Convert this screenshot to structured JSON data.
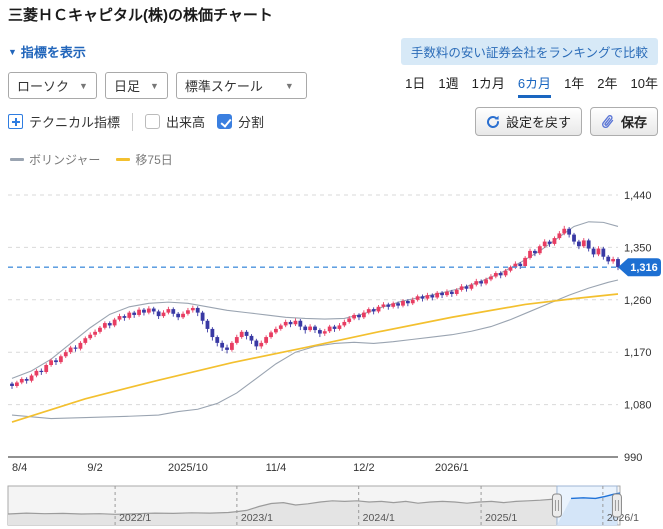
{
  "page": {
    "title": "三菱ＨＣキャピタル(株)の株価チャート"
  },
  "toolbar": {
    "indicator_toggle": "指標を表示",
    "caret_down": "▼",
    "promo_button": "手数料の安い証券会社をランキングで比較",
    "chart_type_select": "ローソク",
    "interval_select": "日足",
    "scale_select": "標準スケール",
    "periods": [
      {
        "label": "1日",
        "selected": false
      },
      {
        "label": "1週",
        "selected": false
      },
      {
        "label": "1カ月",
        "selected": false
      },
      {
        "label": "6カ月",
        "selected": true
      },
      {
        "label": "1年",
        "selected": false
      },
      {
        "label": "2年",
        "selected": false
      },
      {
        "label": "10年",
        "selected": false
      }
    ],
    "technical_button": "テクニカル指標",
    "volume_checkbox": {
      "label": "出来高",
      "checked": false
    },
    "split_checkbox": {
      "label": "分割",
      "checked": true
    },
    "reset_button": "設定を戻す",
    "save_button": "保存"
  },
  "legend": [
    {
      "name": "ボリンジャー",
      "color": "#9aa4b1"
    },
    {
      "name": "移75日",
      "color": "#f3c02f"
    }
  ],
  "chart_data": {
    "type": "candlestick",
    "title": "三菱ＨＣキャピタル(株) 日足 6カ月",
    "ylim": [
      990,
      1466
    ],
    "y_ticks": [
      990,
      1080,
      1170,
      1260,
      1350,
      1440
    ],
    "current_price": 1316,
    "x_ticks": [
      {
        "label": "8/4",
        "index": 0
      },
      {
        "label": "9/2",
        "index": 17
      },
      {
        "label": "2025/10",
        "index": 36
      },
      {
        "label": "11/4",
        "index": 54
      },
      {
        "label": "12/2",
        "index": 72
      },
      {
        "label": "2026/1",
        "index": 90
      }
    ],
    "candles": [
      [
        1116,
        1112,
        1107,
        1119
      ],
      [
        1112,
        1118,
        1109,
        1121
      ],
      [
        1118,
        1124,
        1115,
        1127
      ],
      [
        1124,
        1121,
        1116,
        1127
      ],
      [
        1121,
        1130,
        1118,
        1133
      ],
      [
        1130,
        1138,
        1127,
        1141
      ],
      [
        1138,
        1136,
        1131,
        1142
      ],
      [
        1136,
        1148,
        1133,
        1151
      ],
      [
        1148,
        1156,
        1145,
        1159
      ],
      [
        1156,
        1153,
        1148,
        1160
      ],
      [
        1153,
        1163,
        1150,
        1166
      ],
      [
        1163,
        1170,
        1160,
        1174
      ],
      [
        1170,
        1178,
        1167,
        1181
      ],
      [
        1178,
        1176,
        1171,
        1182
      ],
      [
        1176,
        1186,
        1173,
        1189
      ],
      [
        1186,
        1194,
        1183,
        1197
      ],
      [
        1194,
        1200,
        1191,
        1204
      ],
      [
        1200,
        1205,
        1196,
        1209
      ],
      [
        1205,
        1212,
        1202,
        1215
      ],
      [
        1212,
        1220,
        1209,
        1223
      ],
      [
        1220,
        1216,
        1211,
        1223
      ],
      [
        1216,
        1226,
        1213,
        1229
      ],
      [
        1226,
        1232,
        1223,
        1236
      ],
      [
        1232,
        1229,
        1224,
        1235
      ],
      [
        1229,
        1238,
        1226,
        1241
      ],
      [
        1238,
        1234,
        1229,
        1241
      ],
      [
        1234,
        1243,
        1231,
        1247
      ],
      [
        1243,
        1238,
        1233,
        1246
      ],
      [
        1238,
        1245,
        1235,
        1249
      ],
      [
        1245,
        1240,
        1235,
        1248
      ],
      [
        1240,
        1232,
        1227,
        1243
      ],
      [
        1232,
        1238,
        1229,
        1242
      ],
      [
        1238,
        1244,
        1235,
        1248
      ],
      [
        1244,
        1236,
        1231,
        1247
      ],
      [
        1236,
        1230,
        1225,
        1239
      ],
      [
        1230,
        1236,
        1227,
        1240
      ],
      [
        1236,
        1242,
        1233,
        1246
      ],
      [
        1242,
        1246,
        1238,
        1250
      ],
      [
        1246,
        1238,
        1232,
        1249
      ],
      [
        1238,
        1224,
        1218,
        1241
      ],
      [
        1224,
        1210,
        1204,
        1227
      ],
      [
        1210,
        1196,
        1190,
        1213
      ],
      [
        1196,
        1186,
        1180,
        1199
      ],
      [
        1186,
        1178,
        1172,
        1190
      ],
      [
        1178,
        1174,
        1168,
        1183
      ],
      [
        1174,
        1186,
        1171,
        1189
      ],
      [
        1186,
        1196,
        1183,
        1200
      ],
      [
        1196,
        1205,
        1193,
        1208
      ],
      [
        1205,
        1198,
        1192,
        1208
      ],
      [
        1198,
        1190,
        1184,
        1201
      ],
      [
        1190,
        1180,
        1174,
        1193
      ],
      [
        1180,
        1186,
        1176,
        1190
      ],
      [
        1186,
        1196,
        1183,
        1199
      ],
      [
        1196,
        1204,
        1193,
        1207
      ],
      [
        1204,
        1210,
        1201,
        1214
      ],
      [
        1210,
        1216,
        1207,
        1219
      ],
      [
        1216,
        1222,
        1213,
        1226
      ],
      [
        1222,
        1218,
        1213,
        1225
      ],
      [
        1218,
        1224,
        1215,
        1228
      ],
      [
        1224,
        1214,
        1208,
        1227
      ],
      [
        1214,
        1208,
        1202,
        1217
      ],
      [
        1208,
        1214,
        1205,
        1218
      ],
      [
        1214,
        1208,
        1203,
        1217
      ],
      [
        1208,
        1202,
        1196,
        1211
      ],
      [
        1202,
        1206,
        1198,
        1210
      ],
      [
        1206,
        1214,
        1203,
        1217
      ],
      [
        1214,
        1210,
        1205,
        1217
      ],
      [
        1210,
        1216,
        1207,
        1220
      ],
      [
        1216,
        1222,
        1213,
        1226
      ],
      [
        1222,
        1228,
        1219,
        1232
      ],
      [
        1228,
        1234,
        1225,
        1237
      ],
      [
        1234,
        1230,
        1225,
        1237
      ],
      [
        1230,
        1238,
        1227,
        1242
      ],
      [
        1238,
        1244,
        1235,
        1247
      ],
      [
        1244,
        1240,
        1235,
        1247
      ],
      [
        1240,
        1248,
        1237,
        1251
      ],
      [
        1248,
        1252,
        1245,
        1256
      ],
      [
        1252,
        1248,
        1243,
        1255
      ],
      [
        1248,
        1254,
        1245,
        1257
      ],
      [
        1254,
        1250,
        1245,
        1257
      ],
      [
        1250,
        1258,
        1247,
        1261
      ],
      [
        1258,
        1254,
        1249,
        1261
      ],
      [
        1254,
        1260,
        1251,
        1264
      ],
      [
        1260,
        1266,
        1257,
        1269
      ],
      [
        1266,
        1262,
        1257,
        1269
      ],
      [
        1262,
        1268,
        1259,
        1272
      ],
      [
        1268,
        1264,
        1259,
        1271
      ],
      [
        1264,
        1272,
        1261,
        1275
      ],
      [
        1272,
        1268,
        1263,
        1275
      ],
      [
        1268,
        1274,
        1265,
        1278
      ],
      [
        1274,
        1270,
        1265,
        1277
      ],
      [
        1270,
        1277,
        1267,
        1280
      ],
      [
        1277,
        1283,
        1274,
        1287
      ],
      [
        1283,
        1279,
        1274,
        1286
      ],
      [
        1279,
        1286,
        1276,
        1289
      ],
      [
        1286,
        1292,
        1283,
        1296
      ],
      [
        1292,
        1288,
        1283,
        1295
      ],
      [
        1288,
        1295,
        1285,
        1298
      ],
      [
        1295,
        1300,
        1292,
        1304
      ],
      [
        1300,
        1306,
        1297,
        1309
      ],
      [
        1306,
        1302,
        1297,
        1309
      ],
      [
        1302,
        1310,
        1299,
        1313
      ],
      [
        1310,
        1316,
        1307,
        1319
      ],
      [
        1316,
        1322,
        1313,
        1326
      ],
      [
        1322,
        1318,
        1313,
        1325
      ],
      [
        1318,
        1332,
        1315,
        1335
      ],
      [
        1332,
        1344,
        1329,
        1348
      ],
      [
        1344,
        1340,
        1335,
        1347
      ],
      [
        1340,
        1352,
        1337,
        1355
      ],
      [
        1352,
        1360,
        1349,
        1364
      ],
      [
        1360,
        1356,
        1351,
        1363
      ],
      [
        1356,
        1366,
        1353,
        1369
      ],
      [
        1366,
        1374,
        1363,
        1378
      ],
      [
        1374,
        1382,
        1371,
        1387
      ],
      [
        1382,
        1372,
        1367,
        1385
      ],
      [
        1372,
        1360,
        1355,
        1375
      ],
      [
        1360,
        1352,
        1347,
        1363
      ],
      [
        1352,
        1362,
        1349,
        1366
      ],
      [
        1362,
        1348,
        1343,
        1365
      ],
      [
        1348,
        1338,
        1333,
        1351
      ],
      [
        1338,
        1348,
        1335,
        1352
      ],
      [
        1348,
        1334,
        1329,
        1351
      ],
      [
        1334,
        1326,
        1321,
        1337
      ],
      [
        1326,
        1330,
        1322,
        1334
      ],
      [
        1330,
        1316,
        1311,
        1333
      ]
    ],
    "bollinger_upper": [
      [
        0,
        1125
      ],
      [
        4,
        1138
      ],
      [
        8,
        1158
      ],
      [
        12,
        1185
      ],
      [
        16,
        1212
      ],
      [
        20,
        1235
      ],
      [
        24,
        1248
      ],
      [
        28,
        1254
      ],
      [
        32,
        1256
      ],
      [
        36,
        1254
      ],
      [
        40,
        1248
      ],
      [
        44,
        1242
      ],
      [
        48,
        1238
      ],
      [
        52,
        1234
      ],
      [
        56,
        1230
      ],
      [
        60,
        1228
      ],
      [
        64,
        1227
      ],
      [
        68,
        1228
      ],
      [
        72,
        1236
      ],
      [
        76,
        1248
      ],
      [
        80,
        1258
      ],
      [
        84,
        1265
      ],
      [
        88,
        1272
      ],
      [
        92,
        1280
      ],
      [
        96,
        1292
      ],
      [
        100,
        1306
      ],
      [
        104,
        1324
      ],
      [
        108,
        1344
      ],
      [
        112,
        1368
      ],
      [
        115,
        1386
      ],
      [
        118,
        1394
      ],
      [
        121,
        1393
      ],
      [
        124,
        1386
      ]
    ],
    "bollinger_lower": [
      [
        0,
        1062
      ],
      [
        8,
        1056
      ],
      [
        16,
        1058
      ],
      [
        24,
        1060
      ],
      [
        30,
        1062
      ],
      [
        34,
        1068
      ],
      [
        38,
        1072
      ],
      [
        42,
        1082
      ],
      [
        46,
        1100
      ],
      [
        50,
        1125
      ],
      [
        54,
        1150
      ],
      [
        58,
        1170
      ],
      [
        62,
        1180
      ],
      [
        66,
        1185
      ],
      [
        70,
        1187
      ],
      [
        74,
        1185
      ],
      [
        78,
        1188
      ],
      [
        82,
        1192
      ],
      [
        86,
        1196
      ],
      [
        90,
        1200
      ],
      [
        94,
        1206
      ],
      [
        98,
        1214
      ],
      [
        102,
        1226
      ],
      [
        106,
        1240
      ],
      [
        110,
        1254
      ],
      [
        114,
        1268
      ],
      [
        118,
        1280
      ],
      [
        122,
        1290
      ],
      [
        124,
        1294
      ]
    ],
    "ma75": [
      [
        0,
        1050
      ],
      [
        15,
        1090
      ],
      [
        30,
        1122
      ],
      [
        45,
        1152
      ],
      [
        60,
        1178
      ],
      [
        75,
        1205
      ],
      [
        90,
        1230
      ],
      [
        105,
        1252
      ],
      [
        115,
        1262
      ],
      [
        124,
        1270
      ]
    ],
    "colors": {
      "up": "#e83d62",
      "down": "#3939a4",
      "ma": "#f3c02f",
      "band": "#9aa4b1",
      "price_line": "#4b93dd",
      "badge": "#1d6fd2",
      "grid": "#d9d9d9",
      "axis": "#4d4d4d"
    }
  },
  "navigator": {
    "year_labels": [
      {
        "label": "2022/1",
        "pos": 0.175
      },
      {
        "label": "2023/1",
        "pos": 0.374
      },
      {
        "label": "2024/1",
        "pos": 0.573
      },
      {
        "label": "2025/1",
        "pos": 0.773
      },
      {
        "label": "2026/1",
        "pos": 0.972
      }
    ],
    "selection": {
      "start": 0.897,
      "end": 0.995
    },
    "line": [
      [
        0,
        0.8
      ],
      [
        0.03,
        0.77
      ],
      [
        0.06,
        0.79
      ],
      [
        0.09,
        0.78
      ],
      [
        0.12,
        0.8
      ],
      [
        0.15,
        0.79
      ],
      [
        0.175,
        0.81
      ],
      [
        0.21,
        0.79
      ],
      [
        0.24,
        0.77
      ],
      [
        0.27,
        0.78
      ],
      [
        0.3,
        0.76
      ],
      [
        0.33,
        0.77
      ],
      [
        0.36,
        0.75
      ],
      [
        0.374,
        0.72
      ],
      [
        0.39,
        0.68
      ],
      [
        0.41,
        0.55
      ],
      [
        0.43,
        0.45
      ],
      [
        0.45,
        0.42
      ],
      [
        0.47,
        0.5
      ],
      [
        0.49,
        0.46
      ],
      [
        0.51,
        0.4
      ],
      [
        0.53,
        0.36
      ],
      [
        0.55,
        0.38
      ],
      [
        0.57,
        0.36
      ],
      [
        0.59,
        0.4
      ],
      [
        0.61,
        0.38
      ],
      [
        0.63,
        0.42
      ],
      [
        0.65,
        0.38
      ],
      [
        0.67,
        0.44
      ],
      [
        0.69,
        0.4
      ],
      [
        0.71,
        0.38
      ],
      [
        0.73,
        0.4
      ],
      [
        0.75,
        0.44
      ],
      [
        0.77,
        0.4
      ],
      [
        0.79,
        0.38
      ],
      [
        0.81,
        0.42
      ],
      [
        0.83,
        0.38
      ],
      [
        0.85,
        0.36
      ],
      [
        0.87,
        0.34
      ],
      [
        0.895,
        0.3
      ],
      [
        0.92,
        0.28
      ],
      [
        0.94,
        0.26
      ],
      [
        0.96,
        0.28
      ],
      [
        0.975,
        0.22
      ],
      [
        0.99,
        0.14
      ],
      [
        1,
        0.1
      ]
    ]
  }
}
